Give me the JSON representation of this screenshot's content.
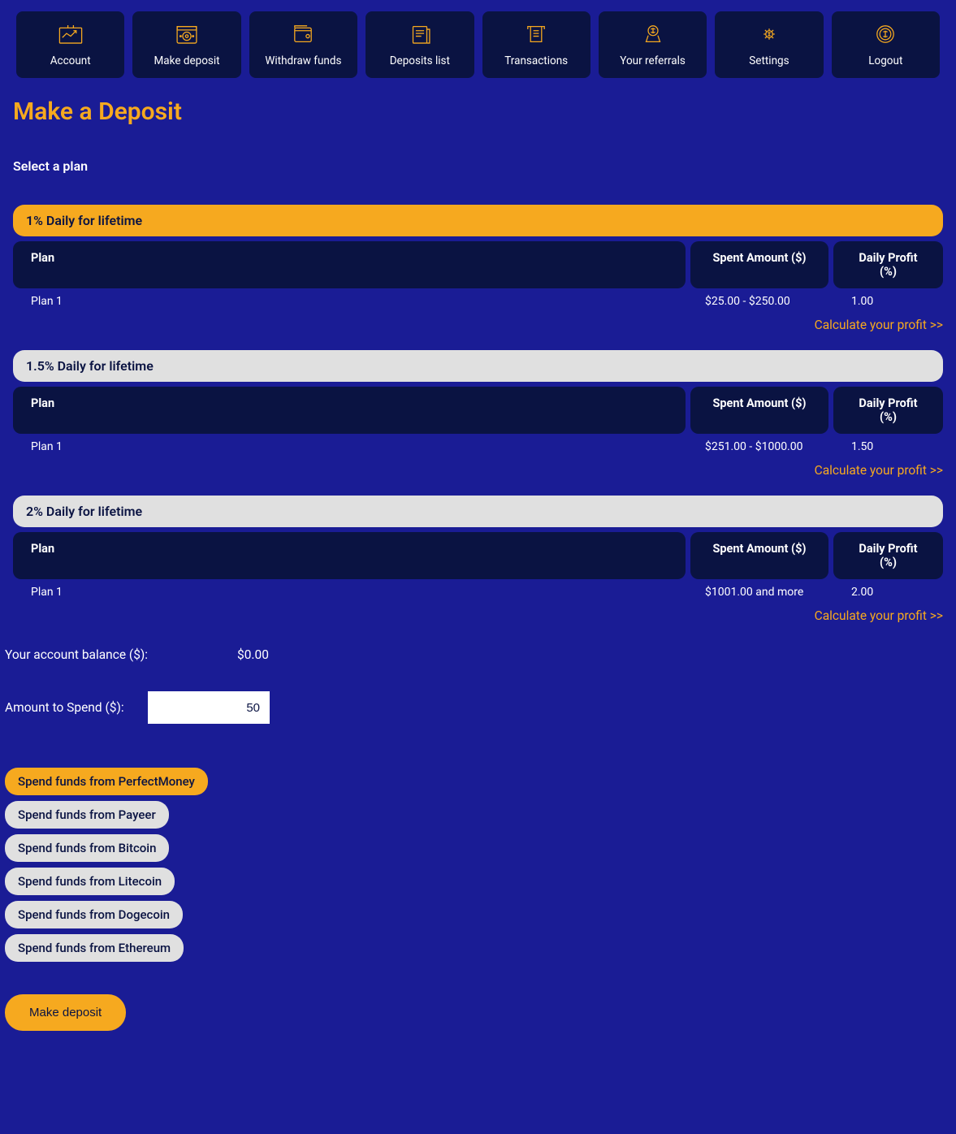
{
  "nav": [
    {
      "label": "Account"
    },
    {
      "label": "Make deposit"
    },
    {
      "label": "Withdraw funds"
    },
    {
      "label": "Deposits list"
    },
    {
      "label": "Transactions"
    },
    {
      "label": "Your referrals"
    },
    {
      "label": "Settings"
    },
    {
      "label": "Logout"
    }
  ],
  "page_title": "Make a Deposit",
  "select_plan_label": "Select a plan",
  "table_headers": {
    "plan": "Plan",
    "spent": "Spent Amount ($)",
    "profit": "Daily Profit (%)"
  },
  "plans": [
    {
      "title": "1% Daily for lifetime",
      "selected": true,
      "row_plan": "Plan 1",
      "row_spent": "$25.00 - $250.00",
      "row_profit": "1.00"
    },
    {
      "title": "1.5% Daily for lifetime",
      "selected": false,
      "row_plan": "Plan 1",
      "row_spent": "$251.00 - $1000.00",
      "row_profit": "1.50"
    },
    {
      "title": "2% Daily for lifetime",
      "selected": false,
      "row_plan": "Plan 1",
      "row_spent": "$1001.00 and more",
      "row_profit": "2.00"
    }
  ],
  "calc_link": "Calculate your profit >>",
  "balance_label": "Your account balance ($):",
  "balance_value": "$0.00",
  "amount_label": "Amount to Spend ($):",
  "amount_value": "50",
  "funding": [
    {
      "label": "Spend funds from PerfectMoney",
      "selected": true
    },
    {
      "label": "Spend funds from Payeer",
      "selected": false
    },
    {
      "label": "Spend funds from Bitcoin",
      "selected": false
    },
    {
      "label": "Spend funds from Litecoin",
      "selected": false
    },
    {
      "label": "Spend funds from Dogecoin",
      "selected": false
    },
    {
      "label": "Spend funds from Ethereum",
      "selected": false
    }
  ],
  "submit_label": "Make deposit"
}
